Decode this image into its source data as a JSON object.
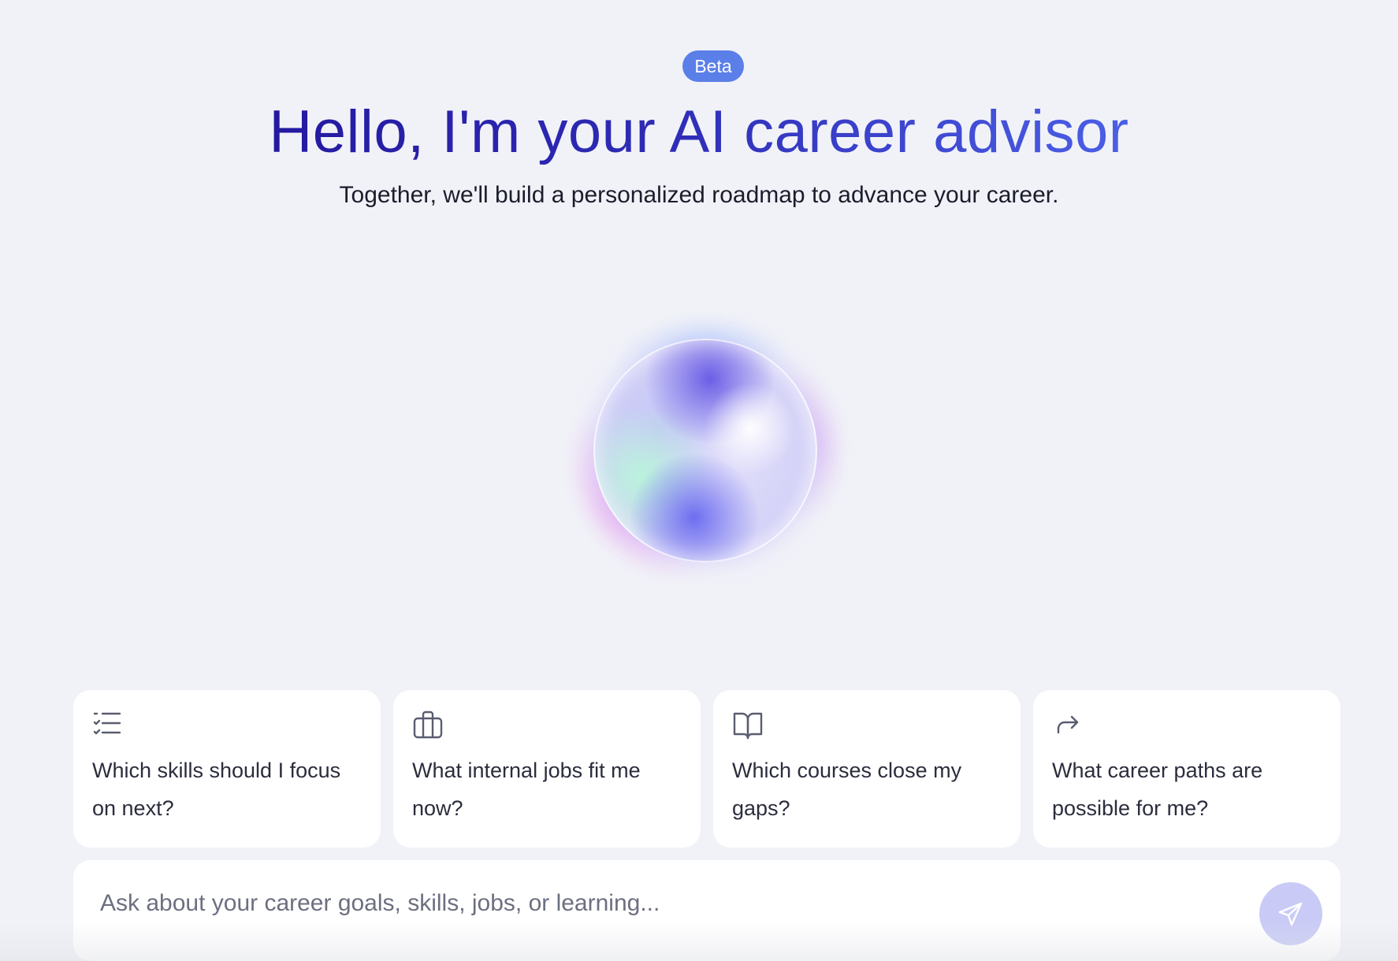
{
  "badge": {
    "label": "Beta",
    "color": "#5b7fe8"
  },
  "hero": {
    "title": "Hello, I'm your AI career advisor",
    "subtitle": "Together, we'll build a personalized roadmap to advance your career."
  },
  "orb": {
    "icon": "ai-orb-animation"
  },
  "suggestions": [
    {
      "icon": "checklist-icon",
      "label": "Which skills should I focus on next?"
    },
    {
      "icon": "briefcase-icon",
      "label": "What internal jobs fit me now?"
    },
    {
      "icon": "book-open-icon",
      "label": "Which courses close my gaps?"
    },
    {
      "icon": "forward-arrow-icon",
      "label": "What career paths are possible for me?"
    }
  ],
  "chat": {
    "placeholder": "Ask about your career goals, skills, jobs, or learning...",
    "value": "",
    "send_icon": "send-icon"
  },
  "colors": {
    "background": "#f1f2f8",
    "title_gradient_start": "#2419a0",
    "title_gradient_end": "#4b5fe6",
    "send_button": "#c9cbf6"
  }
}
